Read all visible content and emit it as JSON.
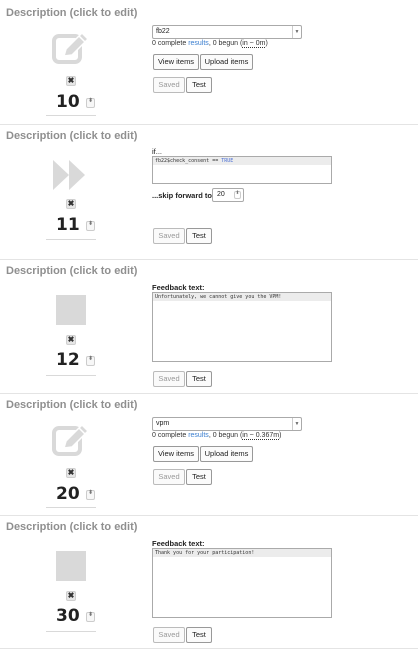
{
  "blocks": [
    {
      "description": "Description (click to edit)",
      "icon": "edit-icon",
      "number": "10",
      "select_value": "fb22",
      "stat_prefix": "0 complete ",
      "stat_link": "results",
      "stat_mid": ", 0 begun (",
      "stat_time": "in ~ 0m",
      "stat_end": ")",
      "view_items": "View items",
      "upload_items": "Upload items",
      "saved": "Saved",
      "test": "Test"
    },
    {
      "description": "Description (click to edit)",
      "icon": "skip-forward-icon",
      "number": "11",
      "if_label": "if...",
      "condition_var": "fb22$check_consent",
      "condition_op": " == ",
      "condition_val": "TRUE",
      "skip_label": "...skip forward to",
      "skip_to": "20",
      "saved": "Saved",
      "test": "Test"
    },
    {
      "description": "Description (click to edit)",
      "icon": "blank-icon",
      "number": "12",
      "feedback_label": "Feedback text:",
      "feedback_text": "Unfortunately, we cannot give you the VPM!",
      "saved": "Saved",
      "test": "Test"
    },
    {
      "description": "Description (click to edit)",
      "icon": "edit-icon",
      "number": "20",
      "select_value": "vpm",
      "stat_prefix": "0 complete ",
      "stat_link": "results",
      "stat_mid": ", 0 begun (",
      "stat_time": "in ~ 0.367m",
      "stat_end": ")",
      "view_items": "View items",
      "upload_items": "Upload items",
      "saved": "Saved",
      "test": "Test"
    },
    {
      "description": "Description (click to edit)",
      "icon": "blank-icon",
      "number": "30",
      "feedback_label": "Feedback text:",
      "feedback_text": "Thank you for your participation!",
      "saved": "Saved",
      "test": "Test"
    }
  ],
  "icons": {
    "delete": "✖",
    "spinner": "⬍",
    "dropdown": "▼"
  },
  "colors": {
    "link": "#3a7ecf",
    "icon_gray": "#d9d9d9",
    "description_gray": "#8f8f8f"
  }
}
